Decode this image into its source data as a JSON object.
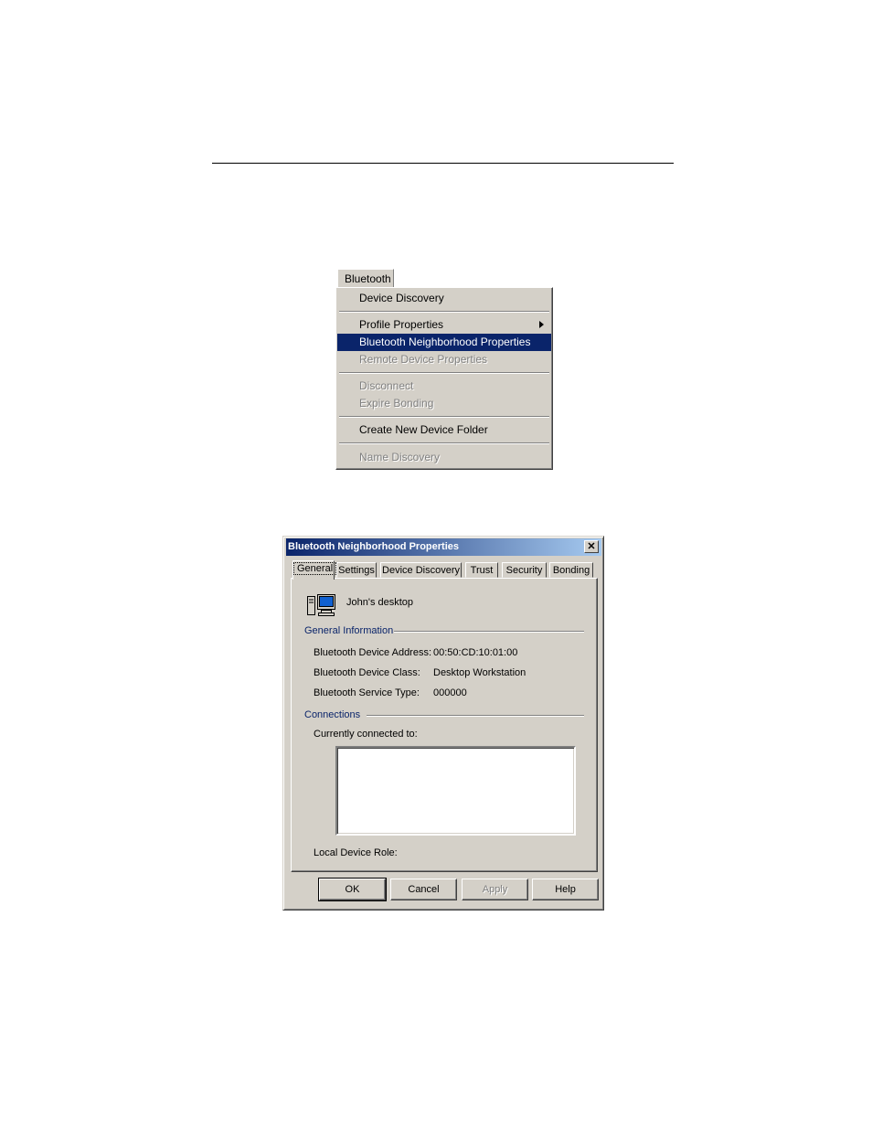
{
  "menu": {
    "title": "Bluetooth",
    "items": [
      {
        "label": "Device Discovery",
        "state": "enabled"
      },
      {
        "label": "Profile Properties",
        "state": "enabled",
        "submenu": true
      },
      {
        "label": "Bluetooth Neighborhood Properties",
        "state": "selected"
      },
      {
        "label": "Remote Device Properties",
        "state": "disabled"
      },
      {
        "label": "Disconnect",
        "state": "disabled"
      },
      {
        "label": "Expire Bonding",
        "state": "disabled"
      },
      {
        "label": "Create New Device Folder",
        "state": "enabled"
      },
      {
        "label": "Name Discovery",
        "state": "disabled"
      }
    ]
  },
  "dialog": {
    "title": "Bluetooth Neighborhood Properties",
    "close_glyph": "✕",
    "tabs": [
      "General",
      "Settings",
      "Device Discovery",
      "Trust",
      "Security",
      "Bonding"
    ],
    "active_tab": "General",
    "device_name": "John's desktop",
    "general_info": {
      "heading": "General Information",
      "address_label": "Bluetooth Device Address:",
      "address_value": "00:50:CD:10:01:00",
      "class_label": "Bluetooth Device Class:",
      "class_value": "Desktop Workstation",
      "service_label": "Bluetooth Service Type:",
      "service_value": "000000"
    },
    "connections": {
      "heading": "Connections",
      "connected_label": "Currently connected to:",
      "connected_items": [],
      "role_label": "Local Device Role:"
    },
    "buttons": {
      "ok": "OK",
      "cancel": "Cancel",
      "apply": "Apply",
      "help": "Help"
    }
  },
  "colors": {
    "face": "#d4d0c8",
    "selection": "#0a246a",
    "title_gradient_end": "#a6caf0",
    "group_heading": "#0a246a"
  },
  "icons": {
    "device": "desktop-computer-icon",
    "submenu": "submenu-arrow-icon"
  }
}
